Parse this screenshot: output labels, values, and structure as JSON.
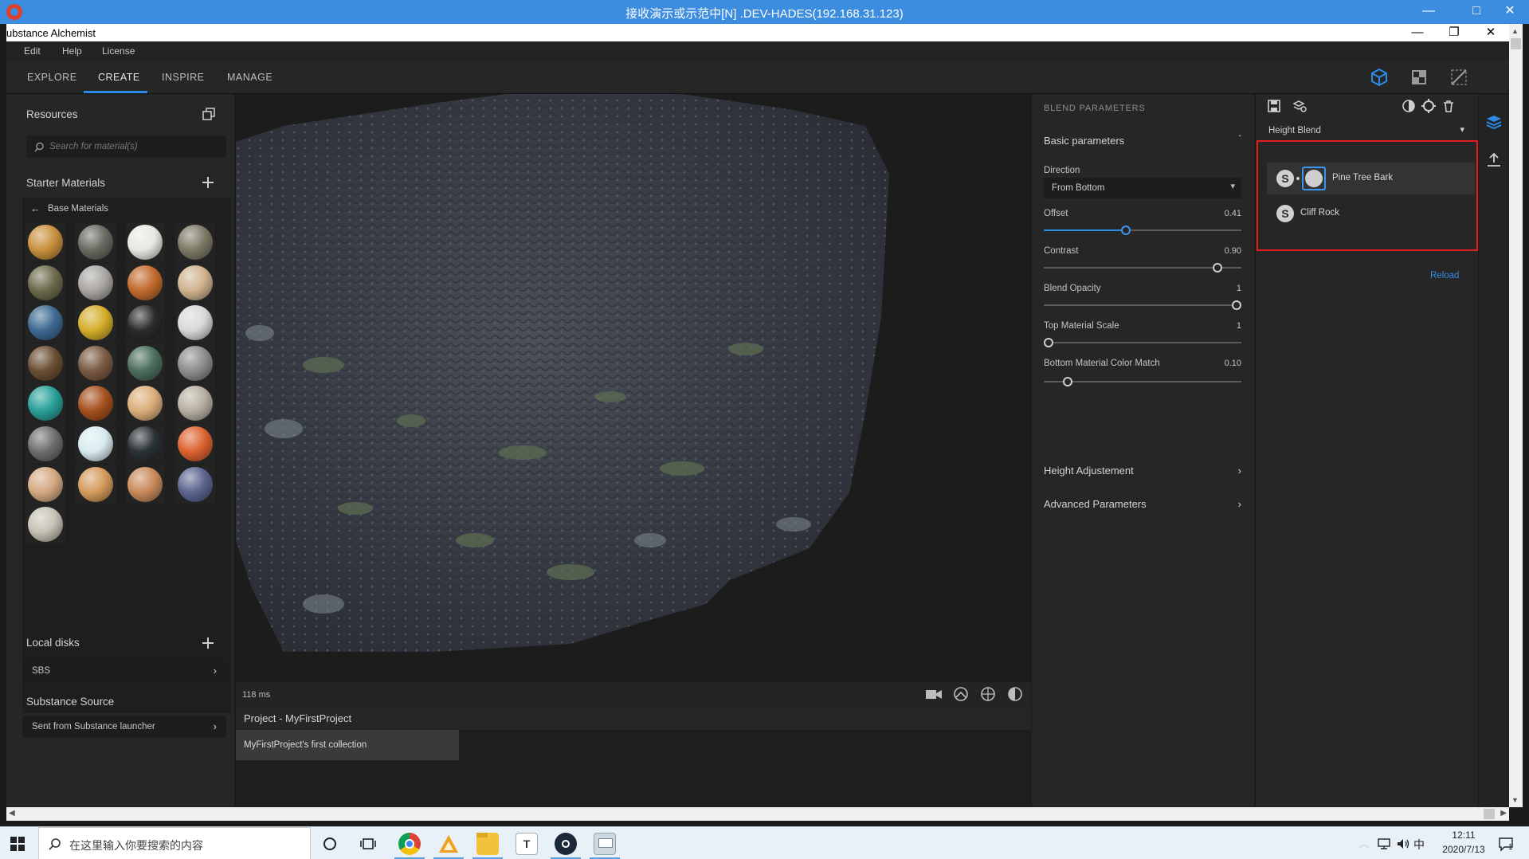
{
  "remote_title": "接收演示或示范中[N] .DEV-HADES(192.168.31.123)",
  "remote_controls": {
    "minimize": "—",
    "maximize": "□",
    "close": "✕"
  },
  "window": {
    "title": "ubstance Alchemist",
    "controls": {
      "minimize": "—",
      "restore": "❐",
      "close": "✕"
    }
  },
  "menu": [
    "Edit",
    "Help",
    "License"
  ],
  "nav_tabs": [
    {
      "label": "EXPLORE",
      "active": false
    },
    {
      "label": "CREATE",
      "active": true
    },
    {
      "label": "INSPIRE",
      "active": false
    },
    {
      "label": "MANAGE",
      "active": false
    }
  ],
  "colors": {
    "accent": "#2b8ce6",
    "highlight_box": "#e02020"
  },
  "left_panel": {
    "resources_title": "Resources",
    "search_placeholder": "Search for material(s)",
    "starter_title": "Starter Materials",
    "base_materials": "Base Materials",
    "materials": [
      [
        "#c9903e",
        "#6a6a62",
        "#e8e8e2",
        "#7d7a66"
      ],
      [
        "#6d6b4b",
        "#a9a6a3",
        "#c26a2d",
        "#d0b38f"
      ],
      [
        "#3e6a93",
        "#d5ad2b",
        "#2c2c2c",
        "#d8d8d8"
      ],
      [
        "#6b4f33",
        "#7a5a42",
        "#4c6e5c",
        "#8d8d8d"
      ],
      [
        "#29a099",
        "#a5501e",
        "#dbae7a",
        "#b7b0a2"
      ],
      [
        "#6e6e6e",
        "#d9ebef",
        "#2a3236",
        "#dd6330"
      ],
      [
        "#d4a982",
        "#d49a5c",
        "#c98a5a",
        "#5d6590"
      ],
      [
        "#c6c2b5"
      ]
    ],
    "local_disks_title": "Local disks",
    "local_disks_items": [
      "SBS"
    ],
    "substance_source_title": "Substance Source",
    "substance_source_items": [
      "Sent from Substance launcher"
    ]
  },
  "viewport": {
    "render_time": "118 ms",
    "project_label": "Project - MyFirstProject",
    "collection": "MyFirstProject's first collection",
    "icons": [
      "camera-icon",
      "environment-icon",
      "grid-icon",
      "material-sphere-icon"
    ]
  },
  "blend": {
    "header": "BLEND PARAMETERS",
    "basic": "Basic parameters",
    "direction_label": "Direction",
    "direction_value": "From Bottom",
    "sliders": [
      {
        "label": "Offset",
        "value": "0.41",
        "fraction": 0.41,
        "active": true
      },
      {
        "label": "Contrast",
        "value": "0.90",
        "fraction": 0.9,
        "active": false
      },
      {
        "label": "Blend Opacity",
        "value": "1",
        "fraction": 1.0,
        "active": false
      },
      {
        "label": "Top Material Scale",
        "value": "1",
        "fraction": 0.0,
        "active": false
      },
      {
        "label": "Bottom Material Color Match",
        "value": "0.10",
        "fraction": 0.1,
        "active": false
      }
    ],
    "height_adjustment": "Height Adjustement",
    "advanced": "Advanced Parameters"
  },
  "layers": {
    "blend_mode": "Height Blend",
    "items": [
      "Pine Tree Bark",
      "Cliff Rock"
    ],
    "reload": "Reload"
  },
  "taskbar": {
    "search_placeholder": "在这里输入你要搜索的内容",
    "time": "12:11",
    "date": "2020/7/13",
    "ime": "中",
    "notifications": "1"
  }
}
